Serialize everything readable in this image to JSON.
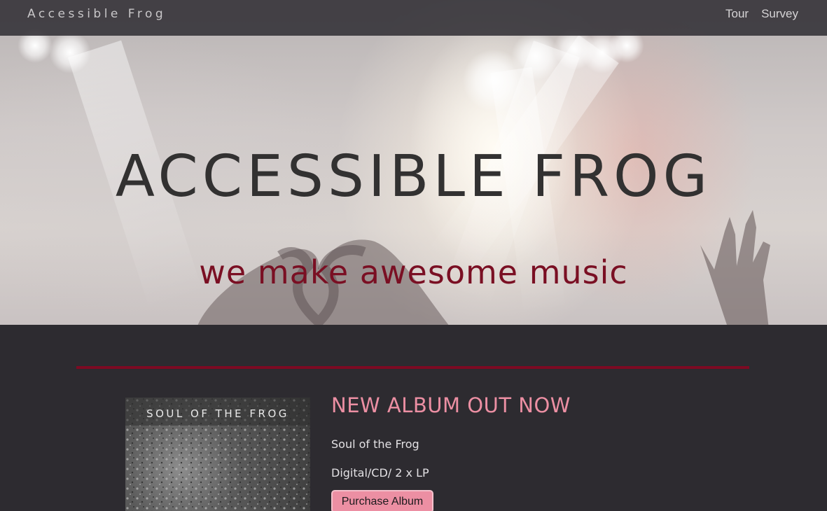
{
  "navbar": {
    "brand": "Accessible Frog",
    "links": [
      "Tour",
      "Survey"
    ]
  },
  "hero": {
    "title": "ACCESSIBLE FROG",
    "subtitle": "we make awesome music"
  },
  "album": {
    "cover_text": "SOUL OF THE FROG",
    "heading": "NEW ALBUM OUT NOW",
    "name": "Soul of the Frog",
    "formats": "Digital/CD/ 2 x LP",
    "purchase_label": "Purchase Album"
  },
  "colors": {
    "background": "#2d2b30",
    "accent": "#7d0a23",
    "pink": "#ec8fa3",
    "title": "#323131"
  }
}
